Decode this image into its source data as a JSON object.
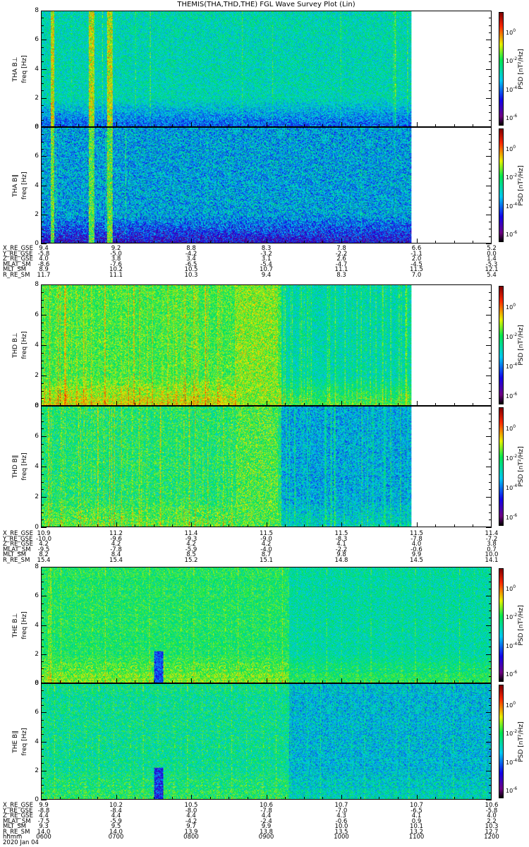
{
  "title": "THEMIS(THA,THD,THE) FGL Wave Survey Plot (Lin)",
  "chart_data": {
    "type": "heatmap",
    "title": "THEMIS(THA,THD,THE) FGL Wave Survey Plot (Lin)",
    "x_range_hours": [
      6,
      12
    ],
    "y_range": [
      0,
      8
    ],
    "ylabel": "freq [Hz]",
    "yticks": [
      "0",
      "2",
      "4",
      "6",
      "8"
    ],
    "colorbar": {
      "label": "PSD [nT²/Hz]",
      "log_range": [
        -6.7,
        1.3
      ],
      "ticks": [
        {
          "exp": "0",
          "value": 0
        },
        {
          "exp": "-2",
          "value": -2
        },
        {
          "exp": "-4",
          "value": -4
        },
        {
          "exp": "-6",
          "value": -6
        }
      ]
    },
    "panels": [
      {
        "name": "THA B⊥",
        "data_end": 10.93,
        "noise": 1.0,
        "lowf_drop": 1.4,
        "streaks": 0.02,
        "segments": [
          {
            "from": 6,
            "to": 12,
            "log_psd": -2.9
          }
        ],
        "bursts": [
          {
            "from": 6.12,
            "to": 6.16,
            "log_psd": -1.0
          },
          {
            "from": 6.62,
            "to": 6.7,
            "log_psd": -1.1
          },
          {
            "from": 6.87,
            "to": 6.94,
            "log_psd": -1.1
          }
        ]
      },
      {
        "name": "THA B∥",
        "data_end": 10.93,
        "noise": 1.3,
        "lowf_drop": 1.6,
        "streaks": 0.02,
        "segments": [
          {
            "from": 6,
            "to": 12,
            "log_psd": -3.6
          }
        ],
        "bursts": [
          {
            "from": 6.12,
            "to": 6.16,
            "log_psd": -1.6
          },
          {
            "from": 6.62,
            "to": 6.7,
            "log_psd": -1.8
          },
          {
            "from": 6.87,
            "to": 6.94,
            "log_psd": -1.7
          }
        ]
      },
      {
        "name": "THD B⊥",
        "data_end": 10.93,
        "noise": 0.9,
        "lowf_drop": -1.0,
        "streaks": 0.25,
        "segments": [
          {
            "from": 6,
            "to": 9.2,
            "log_psd": -1.9
          },
          {
            "from": 9.2,
            "to": 12,
            "log_psd": -2.9
          }
        ],
        "bursts": [
          {
            "from": 8.6,
            "to": 9.15,
            "log_psd": -1.4
          }
        ]
      },
      {
        "name": "THD B∥",
        "data_end": 10.93,
        "noise": 1.1,
        "lowf_drop": -0.6,
        "streaks": 0.25,
        "segments": [
          {
            "from": 6,
            "to": 9.2,
            "log_psd": -2.3
          },
          {
            "from": 9.2,
            "to": 12,
            "log_psd": -3.6
          }
        ],
        "bursts": [
          {
            "from": 8.6,
            "to": 9.15,
            "log_psd": -1.8
          }
        ]
      },
      {
        "name": "THE B⊥",
        "data_end": 12,
        "noise": 0.9,
        "lowf_drop": -0.8,
        "streaks": 0.18,
        "segments": [
          {
            "from": 6,
            "to": 9.3,
            "log_psd": -2.2
          },
          {
            "from": 9.3,
            "to": 12,
            "log_psd": -2.8
          }
        ],
        "bursts": [
          {
            "from": 7.5,
            "to": 7.62,
            "log_psd": -4.4
          }
        ]
      },
      {
        "name": "THE B∥",
        "data_end": 12,
        "noise": 1.1,
        "lowf_drop": -0.5,
        "streaks": 0.18,
        "segments": [
          {
            "from": 6,
            "to": 9.3,
            "log_psd": -2.6
          },
          {
            "from": 9.3,
            "to": 12,
            "log_psd": -3.4
          }
        ],
        "bursts": [
          {
            "from": 7.5,
            "to": 7.62,
            "log_psd": -4.6
          }
        ]
      }
    ],
    "ephemeris": [
      {
        "labels": [
          "X_RE_GSE",
          "Y_RE_GSE",
          "Z_RE_GSE",
          "MLAT_SM",
          "MLT_SM",
          "R_RE_SM"
        ],
        "columns": [
          [
            "9.4",
            "-5.8",
            "4.0",
            "-8.6",
            "8.9",
            "11.7"
          ],
          [
            "9.2",
            "-5.0",
            "3.8",
            "-7.6",
            "10.2",
            "11.1"
          ],
          [
            "8.8",
            "-4.2",
            "3.4",
            "-6.5",
            "10.5",
            "10.3"
          ],
          [
            "8.3",
            "-3.2",
            "3.1",
            "-5.4",
            "10.7",
            "9.4"
          ],
          [
            "7.8",
            "-2.2",
            "2.6",
            "-4.7",
            "11.1",
            "8.3"
          ],
          [
            "6.6",
            "-1.1",
            "2.0",
            "-4.5",
            "11.5",
            "7.0"
          ],
          [
            "5.2",
            "0.0",
            "1.4",
            "-5.3",
            "12.1",
            "5.4"
          ]
        ]
      },
      {
        "labels": [
          "X_RE_GSE",
          "Y_RE_GSE",
          "Z_RE_GSE",
          "MLAT_SM",
          "MLT_SM",
          "R_RE_SM"
        ],
        "columns": [
          [
            "10.9",
            "-10.0",
            "4.2",
            "-9.5",
            "8.2",
            "15.4"
          ],
          [
            "11.2",
            "-9.6",
            "4.2",
            "-7.8",
            "8.4",
            "15.4"
          ],
          [
            "11.4",
            "-9.3",
            "4.2",
            "-5.9",
            "8.5",
            "15.2"
          ],
          [
            "11.5",
            "-9.0",
            "4.2",
            "-4.0",
            "8.7",
            "15.1"
          ],
          [
            "11.5",
            "-8.3",
            "4.1",
            "-2.2",
            "9.8",
            "14.8"
          ],
          [
            "11.5",
            "-7.8",
            "4.0",
            "-0.6",
            "9.9",
            "14.5"
          ],
          [
            "11.4",
            "-7.2",
            "3.8",
            "0.7",
            "10.0",
            "14.1"
          ]
        ]
      },
      {
        "labels": [
          "X_RE_GSE",
          "Y_RE_GSE",
          "Z_RE_GSE",
          "MLAT_SM",
          "MLT_SM",
          "R_RE_SM",
          "hhmm"
        ],
        "columns": [
          [
            "9.9",
            "-8.8",
            "4.4",
            "-7.5",
            "9.3",
            "14.0",
            "0600"
          ],
          [
            "10.2",
            "-8.4",
            "4.4",
            "-5.9",
            "9.5",
            "14.0",
            "0700"
          ],
          [
            "10.5",
            "-8.0",
            "4.4",
            "-4.2",
            "9.7",
            "13.9",
            "0800"
          ],
          [
            "10.6",
            "-7.8",
            "4.4",
            "-2.4",
            "9.9",
            "13.8",
            "0900"
          ],
          [
            "10.7",
            "-7.0",
            "4.3",
            "-0.6",
            "10.0",
            "13.5",
            "1000"
          ],
          [
            "10.7",
            "-6.5",
            "4.1",
            "0.9",
            "10.1",
            "13.2",
            "1100"
          ],
          [
            "10.6",
            "-5.8",
            "4.0",
            "2.2",
            "10.3",
            "12.7",
            "1200"
          ]
        ]
      }
    ],
    "date": "2020 Jan 04"
  }
}
